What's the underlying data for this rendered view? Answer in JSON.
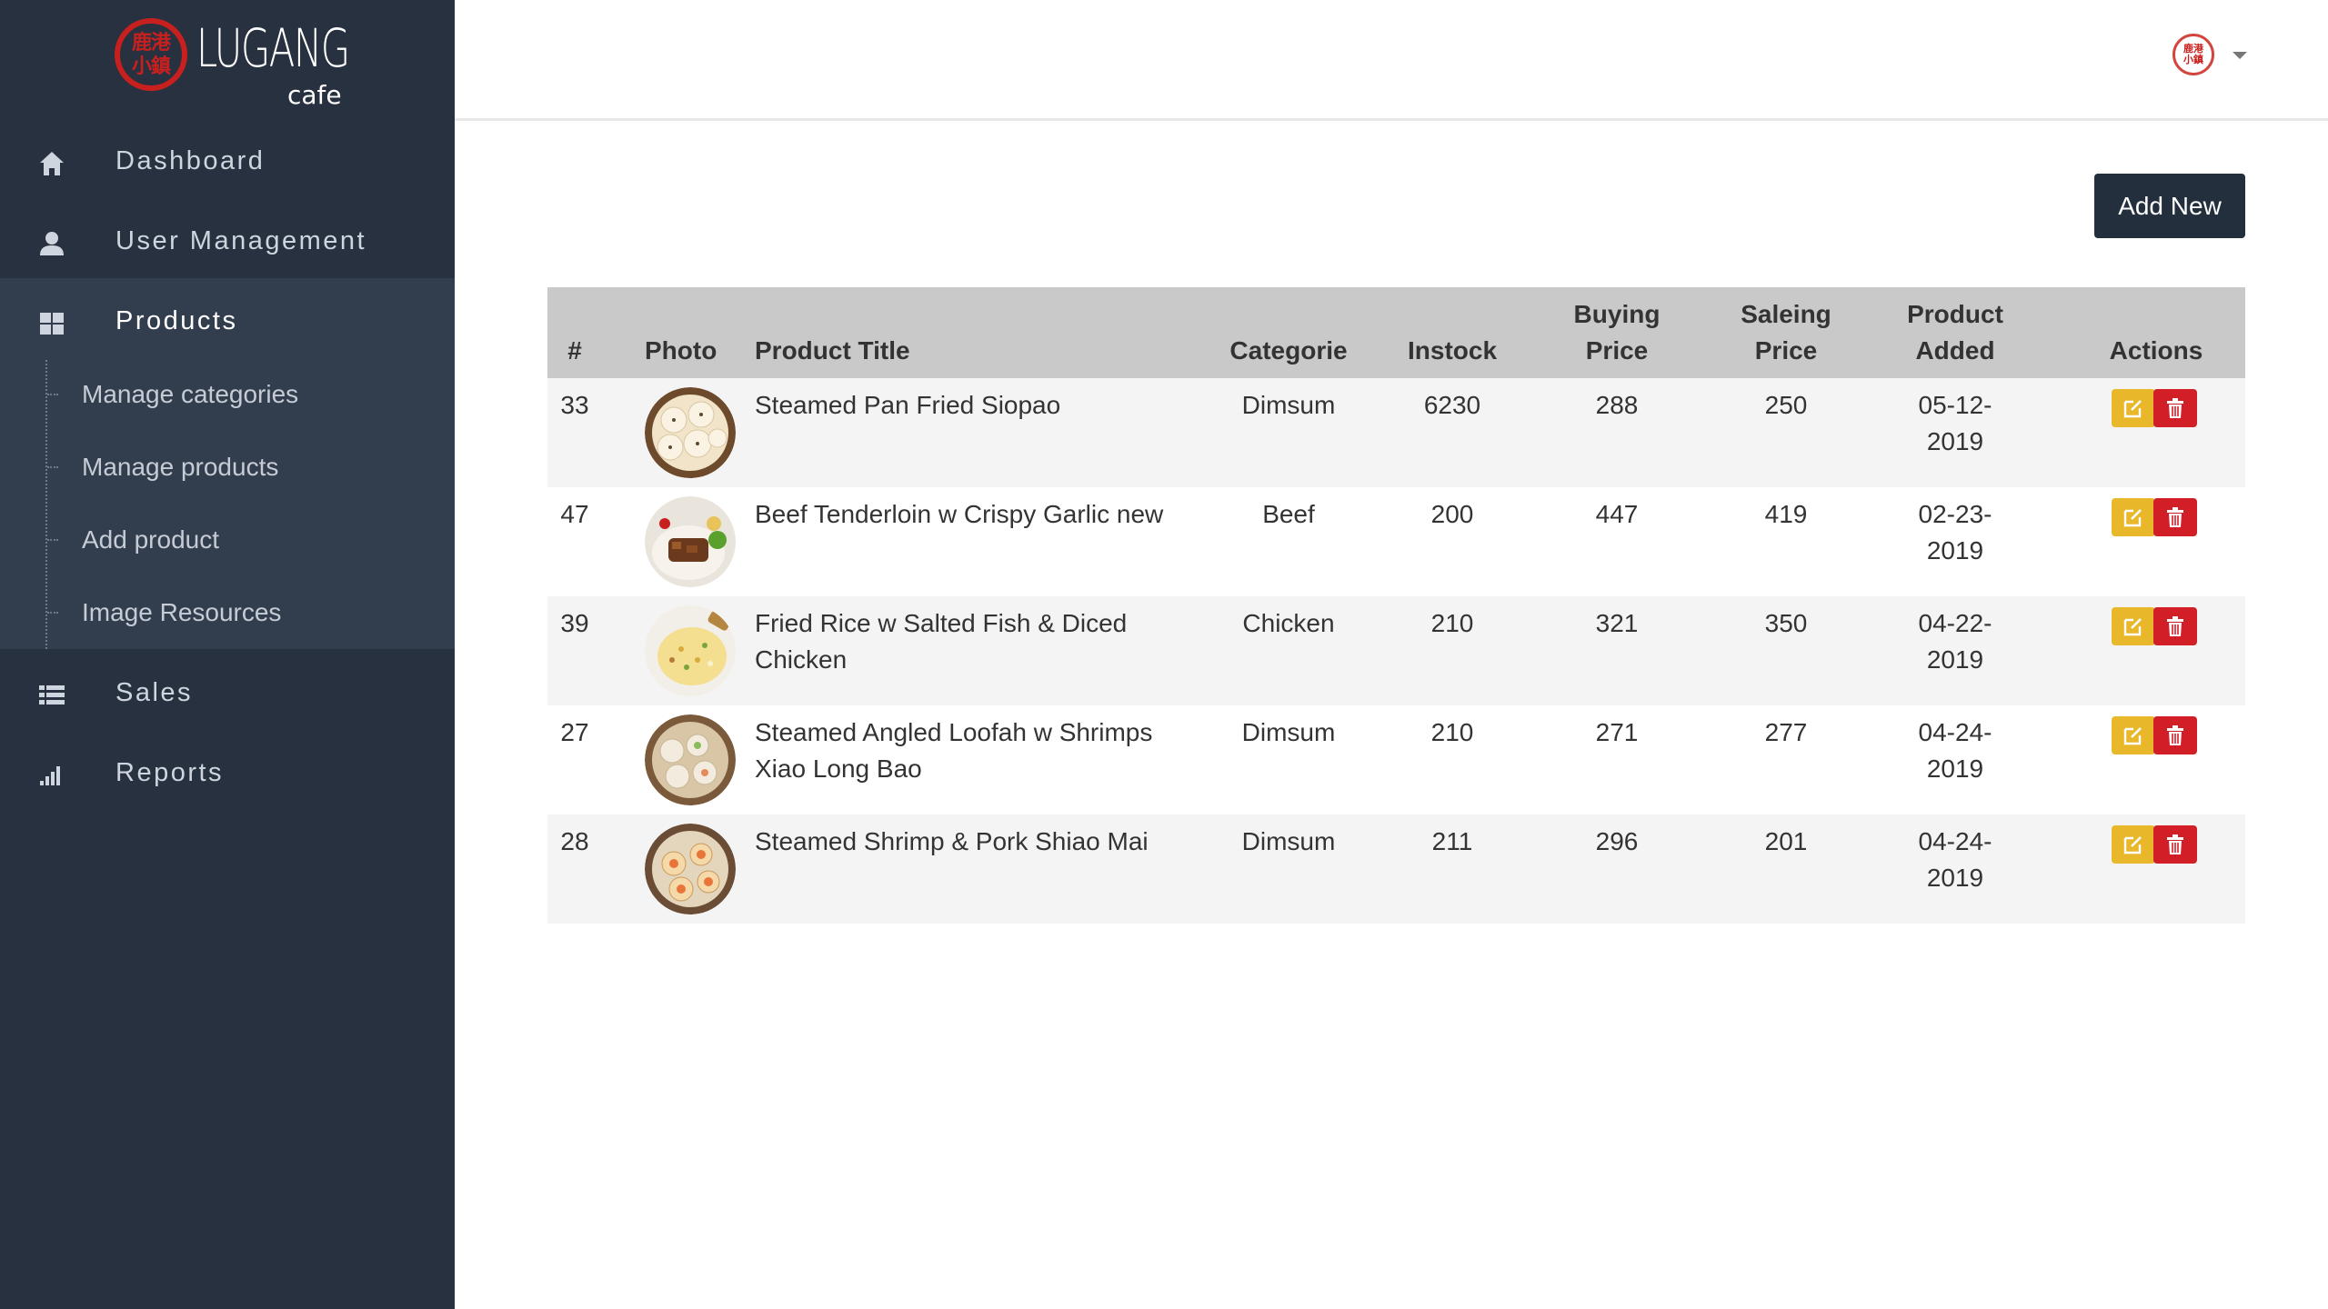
{
  "brand": {
    "seal_text_top": "鹿港",
    "seal_text_bottom": "小鎮",
    "wordmark": "LUGANG",
    "sub": "cafe"
  },
  "sidebar": {
    "items": [
      {
        "label": "Dashboard",
        "icon": "home-icon"
      },
      {
        "label": "User Management",
        "icon": "user-icon"
      },
      {
        "label": "Products",
        "icon": "grid-icon",
        "active": true
      },
      {
        "label": "Sales",
        "icon": "list-icon"
      },
      {
        "label": "Reports",
        "icon": "bar-chart-icon"
      }
    ],
    "products_submenu": [
      {
        "label": "Manage categories"
      },
      {
        "label": "Manage products"
      },
      {
        "label": "Add product"
      },
      {
        "label": "Image Resources"
      }
    ]
  },
  "topbar": {
    "avatar_icon": "user-avatar-icon",
    "avatar_text": "鹿港小鎮"
  },
  "toolbar": {
    "add_new_label": "Add New"
  },
  "table": {
    "headers": {
      "id": "#",
      "photo": "Photo",
      "title": "Product Title",
      "category": "Categorie",
      "instock": "Instock",
      "buying_price": [
        "Buying",
        "Price"
      ],
      "saleing_price": [
        "Saleing",
        "Price"
      ],
      "added": [
        "Product",
        "Added"
      ],
      "actions": "Actions"
    },
    "rows": [
      {
        "id": "33",
        "title_lines": [
          "Steamed Pan Fried Siopao"
        ],
        "category": "Dimsum",
        "instock": "6230",
        "buying": "288",
        "saleing": "250",
        "added": "05-12-2019",
        "photo": "siopao-photo"
      },
      {
        "id": "47",
        "title_lines": [
          "Beef Tenderloin w Crispy Garlic new"
        ],
        "category": "Beef",
        "instock": "200",
        "buying": "447",
        "saleing": "419",
        "added": "02-23-2019",
        "photo": "beef-photo"
      },
      {
        "id": "39",
        "title_lines": [
          "Fried Rice w Salted Fish & Diced",
          "Chicken"
        ],
        "category": "Chicken",
        "instock": "210",
        "buying": "321",
        "saleing": "350",
        "added": "04-22-2019",
        "photo": "fried-rice-photo"
      },
      {
        "id": "27",
        "title_lines": [
          "Steamed Angled Loofah w Shrimps",
          "Xiao Long Bao"
        ],
        "category": "Dimsum",
        "instock": "210",
        "buying": "271",
        "saleing": "277",
        "added": "04-24-2019",
        "photo": "xiao-long-bao-photo"
      },
      {
        "id": "28",
        "title_lines": [
          "Steamed Shrimp & Pork Shiao Mai"
        ],
        "category": "Dimsum",
        "instock": "211",
        "buying": "296",
        "saleing": "201",
        "added": "04-24-2019",
        "photo": "shiao-mai-photo"
      }
    ],
    "action_icons": {
      "edit": "edit-icon",
      "delete": "trash-icon"
    }
  },
  "colors": {
    "sidebar_bg": "#27313f",
    "submenu_bg": "#323d4d",
    "header_bg": "#c9c9c9",
    "edit": "#e9b82a",
    "delete": "#d21e26",
    "primary_button": "#232f3c"
  }
}
